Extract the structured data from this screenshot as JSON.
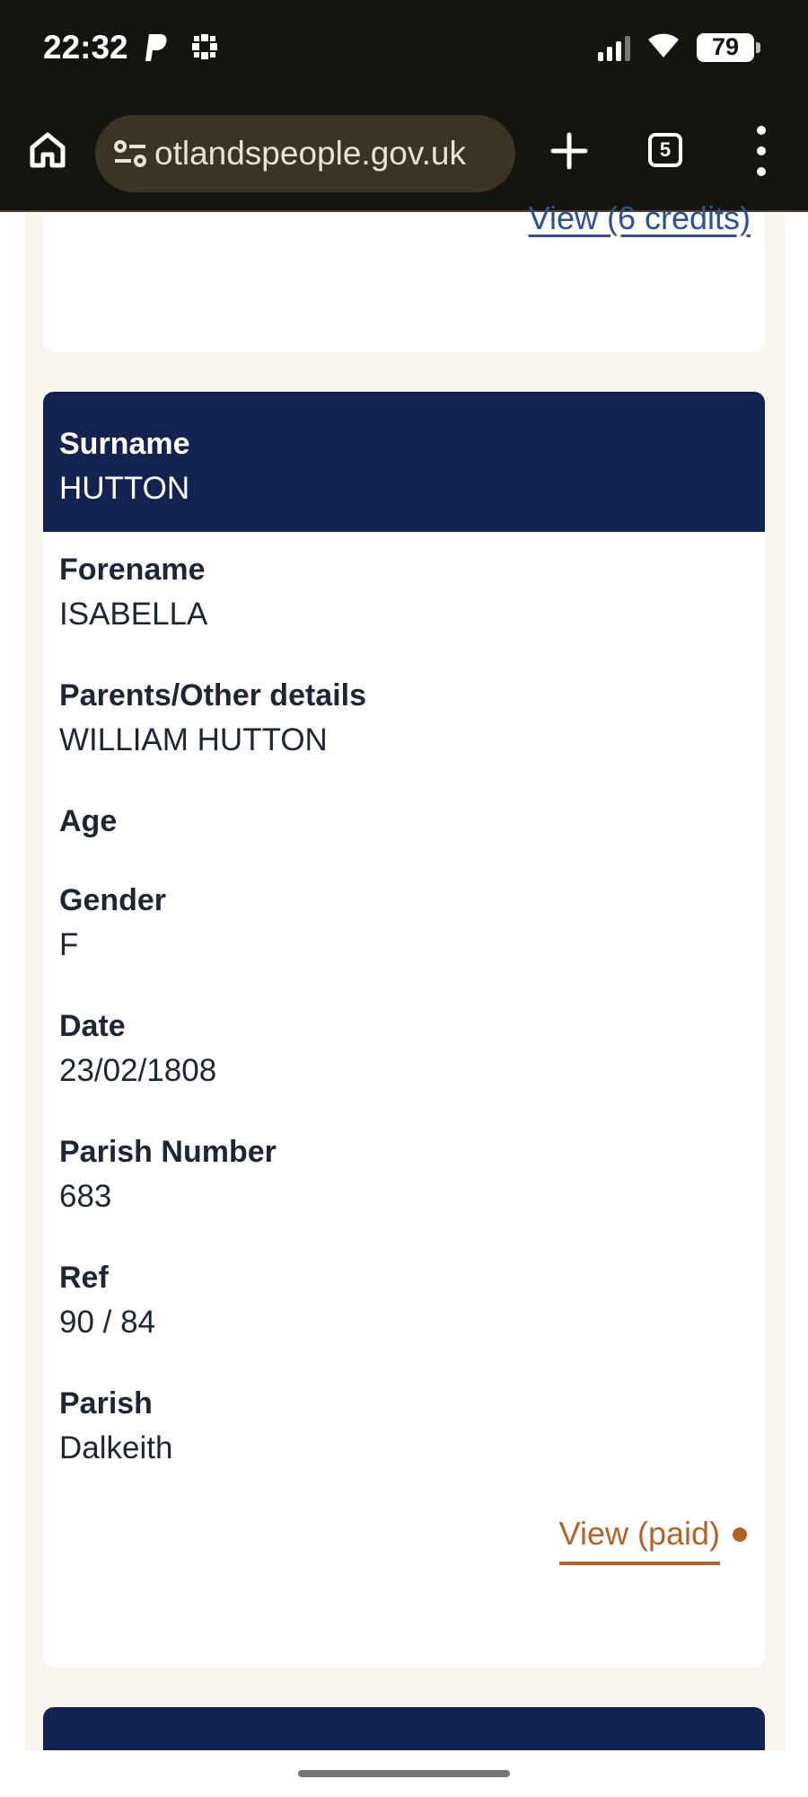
{
  "status_bar": {
    "time": "22:32",
    "battery": "79",
    "icons": [
      "paypal-icon",
      "bank-app-icon",
      "signal-icon",
      "wifi-icon",
      "battery-icon"
    ]
  },
  "browser": {
    "url": "otlandspeople.gov.uk",
    "tab_count": "5",
    "icons": [
      "home-icon",
      "site-settings-icon",
      "new-tab-plus-icon",
      "tabs-icon",
      "more-menu-icon"
    ]
  },
  "previous_record": {
    "view_link": "View (6 credits)"
  },
  "record": {
    "surname_label": "Surname",
    "surname": "HUTTON",
    "fields": {
      "forename_label": "Forename",
      "forename": "ISABELLA",
      "parents_label": "Parents/Other details",
      "parents": "WILLIAM HUTTON",
      "age_label": "Age",
      "gender_label": "Gender",
      "gender": "F",
      "date_label": "Date",
      "date": "23/02/1808",
      "parish_number_label": "Parish Number",
      "parish_number": "683",
      "ref_label": "Ref",
      "ref": "90 / 84",
      "parish_label": "Parish",
      "parish": "Dalkeith"
    },
    "view_link": "View (paid)"
  },
  "colors": {
    "header_navy": "#13224f",
    "link_blue": "#30518f",
    "paid_orange": "#b1632a",
    "page_bg": "#f8f5ee"
  }
}
